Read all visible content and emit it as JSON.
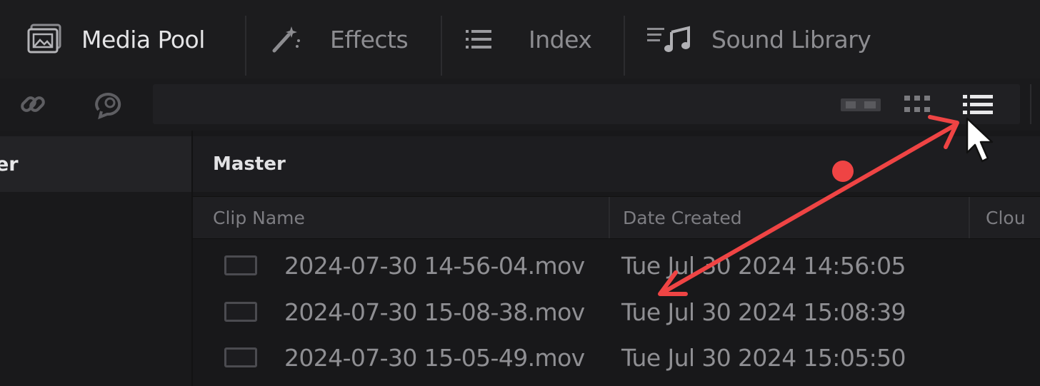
{
  "tabs": [
    {
      "label": "Media Pool",
      "icon": "media-pool-icon",
      "active": true
    },
    {
      "label": "Effects",
      "icon": "magic-wand-icon",
      "active": false
    },
    {
      "label": "Index",
      "icon": "list-icon",
      "active": false
    },
    {
      "label": "Sound Library",
      "icon": "music-library-icon",
      "active": false
    }
  ],
  "subtoolbar": {
    "left_icons": [
      "link-icon",
      "sync-icon"
    ],
    "view_buttons": [
      "filmstrip-view-icon",
      "thumbnail-view-icon",
      "list-view-icon"
    ]
  },
  "bin_panel": {
    "selected_bin_partial": "er"
  },
  "list": {
    "header": "Master",
    "columns": [
      "Clip Name",
      "Date Created",
      "Clou"
    ],
    "rows": [
      {
        "name": "2024-07-30 14-56-04.mov",
        "date": "Tue Jul 30 2024 14:56:05"
      },
      {
        "name": "2024-07-30 15-08-38.mov",
        "date": "Tue Jul 30 2024 15:08:39"
      },
      {
        "name": "2024-07-30 15-05-49.mov",
        "date": "Tue Jul 30 2024 15:05:50"
      }
    ]
  },
  "annotation": {
    "color": "#ef4444",
    "type": "double-headed-arrow"
  },
  "colors": {
    "background": "#1b1b1d",
    "text_dim": "#8f8f93",
    "text_bright": "#e4e4e6"
  }
}
